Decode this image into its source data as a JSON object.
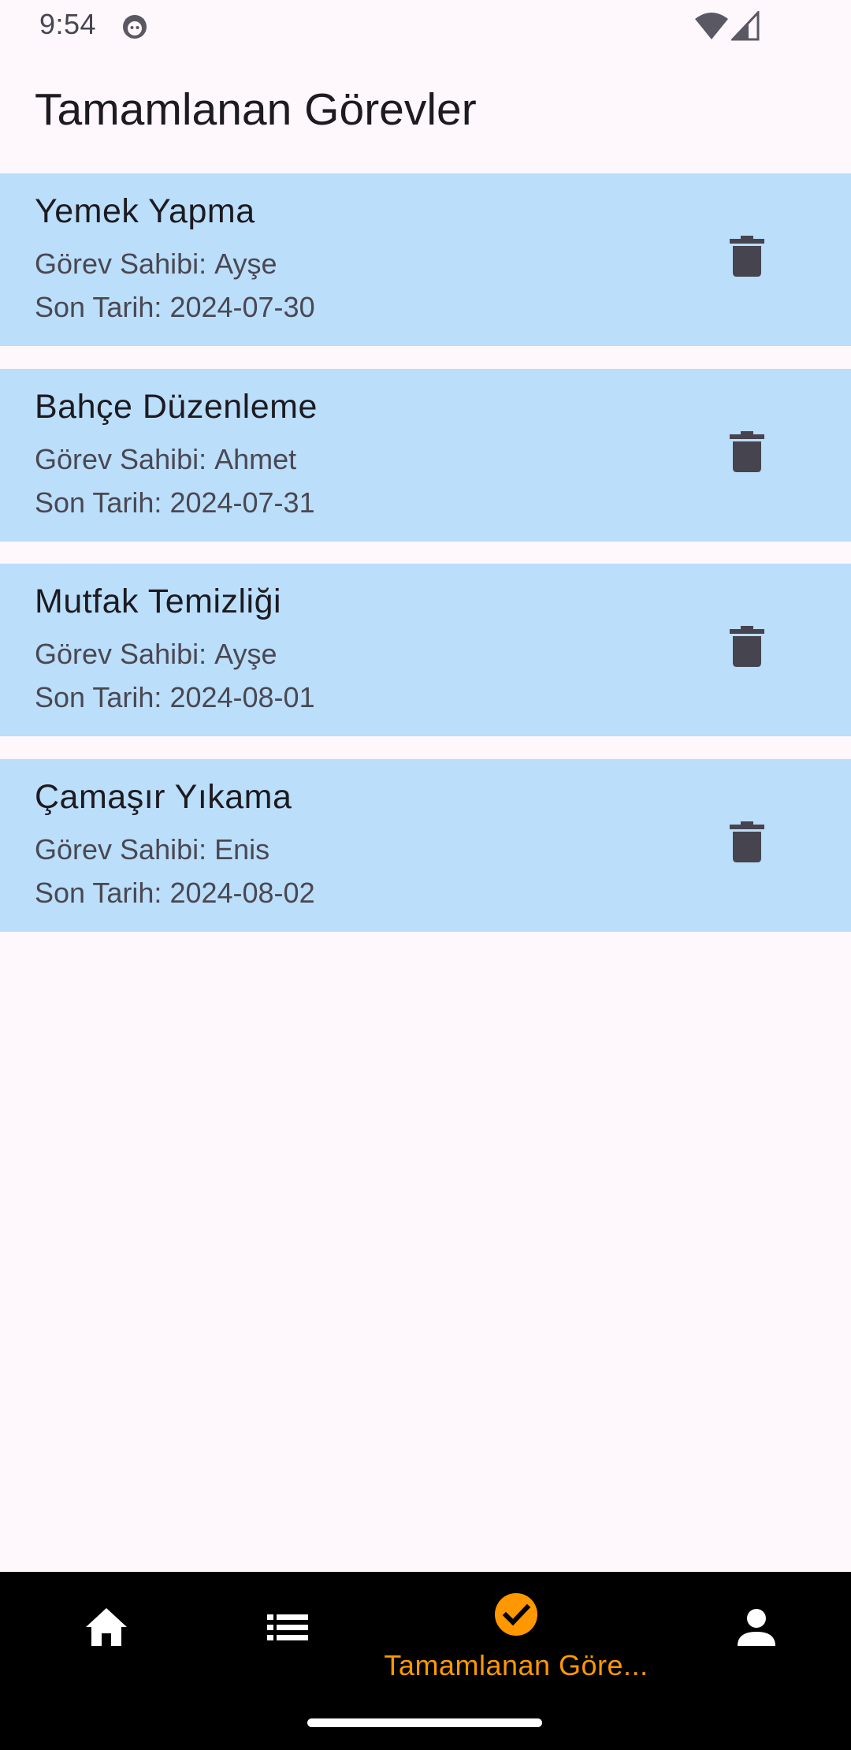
{
  "status_bar": {
    "time": "9:54",
    "icons": [
      "app-notification-icon",
      "wifi-icon",
      "cell-signal-icon"
    ]
  },
  "app_bar": {
    "title": "Tamamlanan Görevler"
  },
  "tasks": [
    {
      "title": "Yemek Yapma",
      "owner_label": "Görev Sahibi:",
      "owner": "Ayşe",
      "date_label": "Son Tarih:",
      "date": "2024-07-30"
    },
    {
      "title": "Bahçe Düzenleme",
      "owner_label": "Görev Sahibi:",
      "owner": "Ahmet",
      "date_label": "Son Tarih:",
      "date": "2024-07-31"
    },
    {
      "title": "Mutfak Temizliği",
      "owner_label": "Görev Sahibi:",
      "owner": "Ayşe",
      "date_label": "Son Tarih:",
      "date": "2024-08-01"
    },
    {
      "title": "Çamaşır Yıkama",
      "owner_label": "Görev Sahibi:",
      "owner": "Enis",
      "date_label": "Son Tarih:",
      "date": "2024-08-02"
    }
  ],
  "bottom_nav": {
    "items": [
      {
        "icon": "home-icon",
        "label": ""
      },
      {
        "icon": "list-icon",
        "label": ""
      },
      {
        "icon": "check-circle-icon",
        "label": "Tamamlanan Göre...",
        "active": true
      },
      {
        "icon": "person-icon",
        "label": ""
      }
    ],
    "active_color": "#ff9800",
    "inactive_color": "#ffffff"
  },
  "colors": {
    "background": "#fef7fc",
    "card": "#bbdefa",
    "icon": "#46444f",
    "nav_background": "#000000"
  }
}
